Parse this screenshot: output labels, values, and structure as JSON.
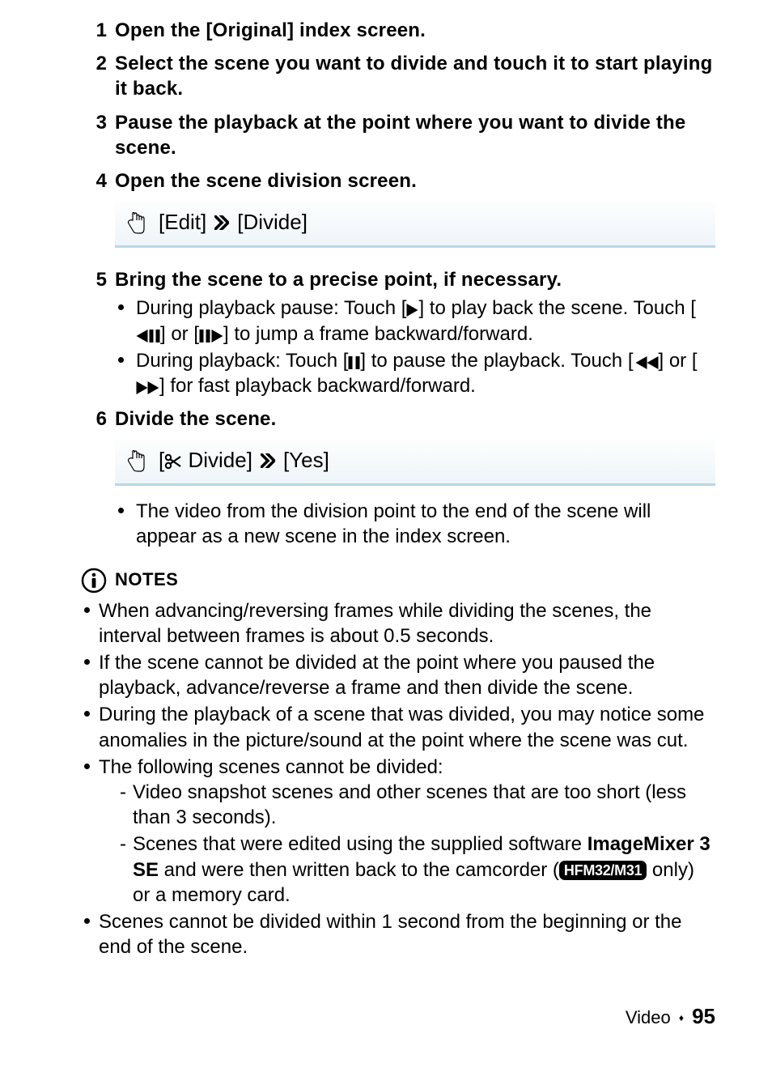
{
  "steps": {
    "s1": {
      "num": "1",
      "head": "Open the [Original] index screen."
    },
    "s2": {
      "num": "2",
      "head": "Select the scene you want to divide and touch it to start playing it back."
    },
    "s3": {
      "num": "3",
      "head": "Pause the playback at the point where you want to divide the scene."
    },
    "s4": {
      "num": "4",
      "head": "Open the scene division screen."
    },
    "s5": {
      "num": "5",
      "head": "Bring the scene to a precise point, if necessary.",
      "b1_a": "During playback pause: Touch [",
      "b1_b": "] to play back the scene. Touch [",
      "b1_c": "] or [",
      "b1_d": "] to jump a frame backward/forward.",
      "b2_a": "During playback: Touch [",
      "b2_b": "] to pause the playback. Touch [",
      "b2_c": "] or [",
      "b2_d": "] for fast playback backward/forward."
    },
    "s6": {
      "num": "6",
      "head": "Divide the scene.",
      "after": "The video from the division point to the end of the scene will appear as a new scene in the index screen."
    }
  },
  "panel1": {
    "a": "[Edit]",
    "b": "[Divide]"
  },
  "panel2": {
    "a_open": "[",
    "a_label": " Divide]",
    "b": "[Yes]"
  },
  "notesHeading": "NOTES",
  "notes": {
    "n1": "When advancing/reversing frames while dividing the scenes, the interval between frames is about 0.5 seconds.",
    "n2": "If the scene cannot be divided at the point where you paused the playback, advance/reverse a frame and then divide the scene.",
    "n3": "During the playback of a scene that was divided, you may notice some anomalies in the picture/sound at the point where the scene was cut.",
    "n4": "The following scenes cannot be divided:",
    "n4s1": "Video snapshot scenes and other scenes that are too short (less than 3 seconds).",
    "n4s2_a": "Scenes that were edited using the supplied software ",
    "n4s2_b_bold": "ImageMixer 3 SE",
    "n4s2_c": " and were then written back to the camcorder (",
    "n4s2_badge": "HFM32/M31",
    "n4s2_d": " only) or a memory card.",
    "n5": "Scenes cannot be divided within 1 second from the beginning or the end of the scene."
  },
  "footer": {
    "section": "Video",
    "page": "95"
  }
}
